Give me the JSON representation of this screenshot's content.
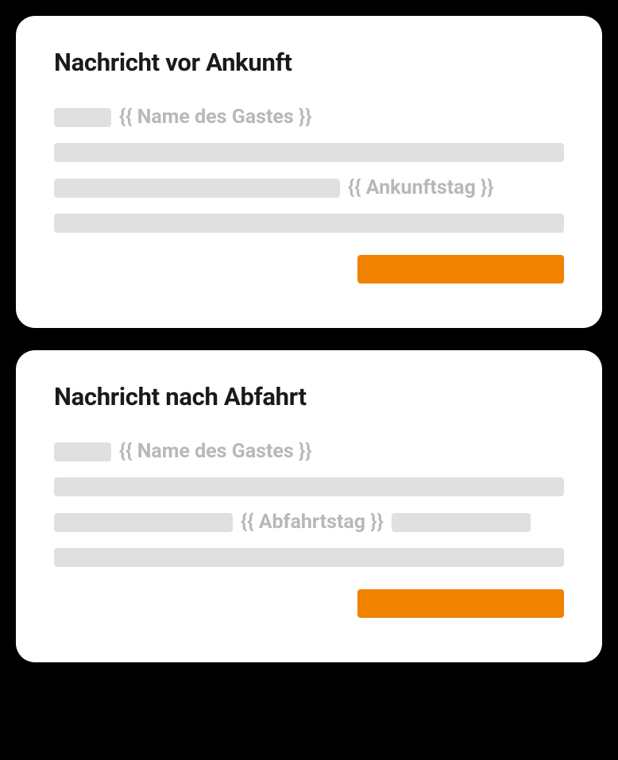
{
  "cards": {
    "arrival": {
      "title": "Nachricht vor Ankunft",
      "variables": {
        "guest_name": "{{ Name des Gastes }}",
        "day": "{{ Ankunftstag }}"
      }
    },
    "departure": {
      "title": "Nachricht nach Abfahrt",
      "variables": {
        "guest_name": "{{ Name des Gastes }}",
        "day": "{{ Abfahrtstag }}"
      }
    }
  },
  "colors": {
    "accent": "#f08200",
    "placeholder": "#e0e0e0",
    "variable_text": "#b8b8b8"
  }
}
